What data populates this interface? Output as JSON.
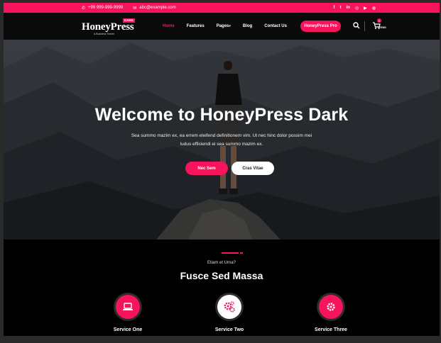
{
  "topbar": {
    "phone": "+99 999-999-9999",
    "email": "abc@example.com",
    "social": [
      "f",
      "t",
      "in",
      "◎",
      "▶",
      "◍"
    ]
  },
  "brand": {
    "name_first": "H",
    "name_rest": "oneyPress",
    "badge": "DARK",
    "tagline": "A Business Theme"
  },
  "nav": {
    "items": [
      "Home",
      "Features",
      "Pages",
      "Blog",
      "Contact Us"
    ],
    "active": "Home",
    "cta": "HoneyPress Pro",
    "cart_count": "0",
    "cart_label": "ITEMS"
  },
  "hero": {
    "title": "Welcome to HoneyPress Dark",
    "subtitle": "Sea summo mazim ex, ea errem eleifend definitionem vim. Ut nec hinc dolor possim mei ludus efficiendi ei sea summo mazim ex.",
    "primary_button": "Nec Sem",
    "secondary_button": "Cras Vitae"
  },
  "services": {
    "kicker": "Etiam et Urna?",
    "title": "Fusce Sed Massa",
    "items": [
      {
        "label": "Service One",
        "icon": "laptop-icon"
      },
      {
        "label": "Service Two",
        "icon": "gears-icon"
      },
      {
        "label": "Service Three",
        "icon": "gear-icon"
      }
    ]
  },
  "colors": {
    "accent": "#f8145c",
    "background": "#000000"
  }
}
